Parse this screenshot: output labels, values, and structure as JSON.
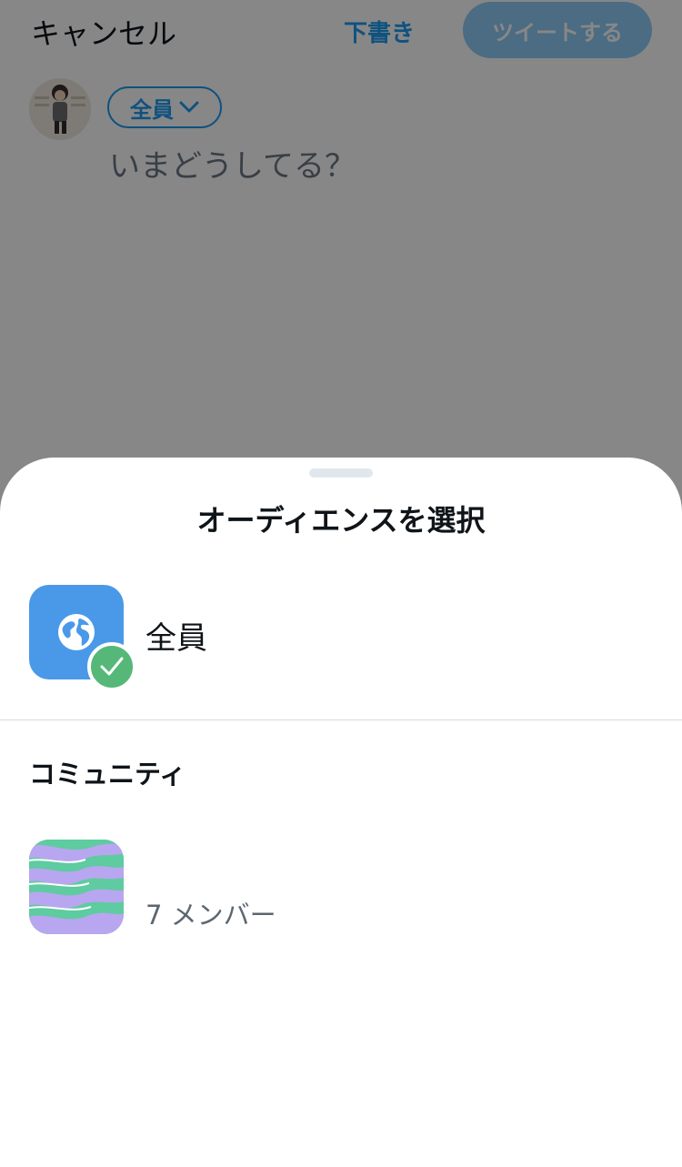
{
  "compose": {
    "cancel_label": "キャンセル",
    "draft_label": "下書き",
    "tweet_label": "ツイートする",
    "audience_label": "全員",
    "placeholder": "いまどうしてる？"
  },
  "sheet": {
    "title": "オーディエンスを選択",
    "everyone": {
      "label": "全員",
      "icon": "globe-icon",
      "selected": true
    },
    "community_heading": "コミュニティ",
    "communities": [
      {
        "name": "",
        "members": "7 メンバー"
      }
    ]
  },
  "colors": {
    "accent": "#1d9bf0",
    "globe_tile": "#4a99e9",
    "check_badge": "#55b878"
  }
}
